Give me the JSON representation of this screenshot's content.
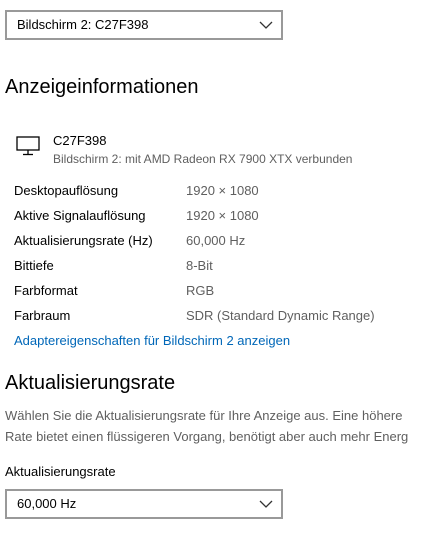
{
  "display_selector": {
    "value": "Bildschirm 2: C27F398",
    "icon": "chevron-down-icon"
  },
  "display_info": {
    "heading": "Anzeigeinformationen",
    "monitor": {
      "icon": "monitor-icon",
      "name": "C27F398",
      "subtitle": "Bildschirm 2: mit AMD Radeon RX 7900 XTX verbunden"
    },
    "rows": [
      {
        "label": "Desktopauflösung",
        "value": "1920 × 1080"
      },
      {
        "label": "Aktive Signalauflösung",
        "value": "1920 × 1080"
      },
      {
        "label": "Aktualisierungsrate (Hz)",
        "value": "60,000 Hz"
      },
      {
        "label": "Bittiefe",
        "value": "8-Bit"
      },
      {
        "label": "Farbformat",
        "value": "RGB"
      },
      {
        "label": "Farbraum",
        "value": "SDR (Standard Dynamic Range)"
      }
    ],
    "adapter_link": "Adaptereigenschaften für Bildschirm 2 anzeigen"
  },
  "refresh_rate": {
    "heading": "Aktualisierungsrate",
    "description_line1": "Wählen Sie die Aktualisierungsrate für Ihre Anzeige aus. Eine höhere",
    "description_line2": "Rate bietet einen flüssigeren Vorgang, benötigt aber auch mehr Energ",
    "field_label": "Aktualisierungsrate",
    "selected_value": "60,000 Hz"
  },
  "colors": {
    "link": "#0067b8",
    "secondary_text": "#5f5f5f",
    "dropdown_border": "#999999"
  }
}
